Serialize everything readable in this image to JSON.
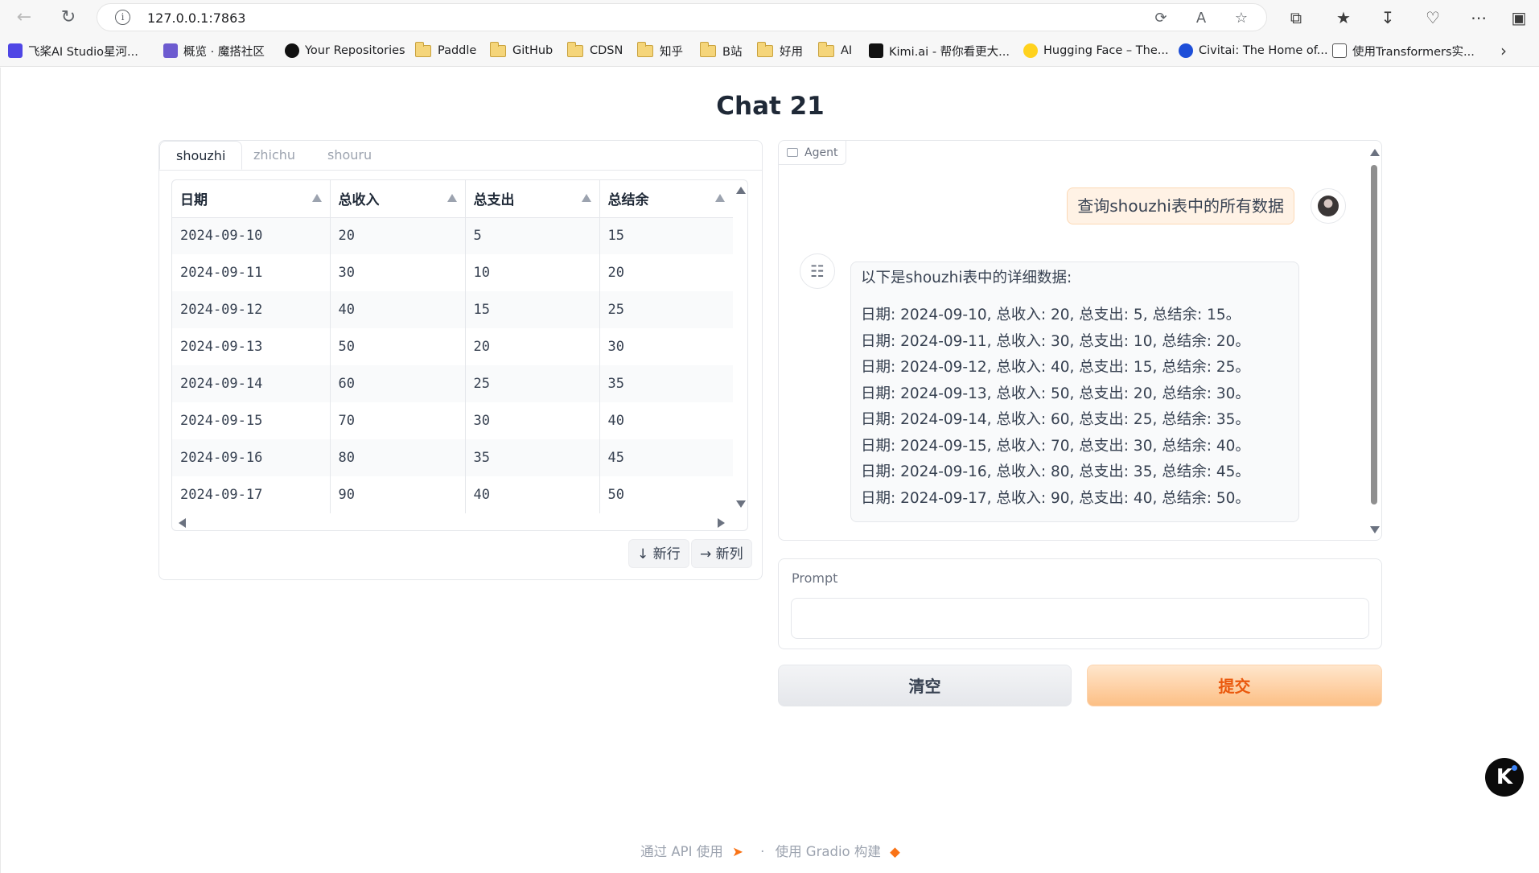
{
  "browser": {
    "url": "127.0.0.1:7863",
    "bookmarks": [
      {
        "label": "飞桨AI Studio星河...",
        "icon": "paddle-icon",
        "color": "#4f46e5"
      },
      {
        "label": "概览 · 魔搭社区",
        "icon": "modelscope-icon",
        "color": "#6d5bd0"
      },
      {
        "label": "Your Repositories",
        "icon": "github-icon",
        "color": "#111111"
      },
      {
        "label": "Paddle",
        "icon": "folder-icon"
      },
      {
        "label": "GitHub",
        "icon": "folder-icon"
      },
      {
        "label": "CDSN",
        "icon": "folder-icon"
      },
      {
        "label": "知乎",
        "icon": "folder-icon"
      },
      {
        "label": "B站",
        "icon": "folder-icon"
      },
      {
        "label": "好用",
        "icon": "folder-icon"
      },
      {
        "label": "AI",
        "icon": "folder-icon"
      },
      {
        "label": "Kimi.ai - 帮你看更大...",
        "icon": "kimi-icon",
        "color": "#111111"
      },
      {
        "label": "Hugging Face – The...",
        "icon": "huggingface-icon",
        "color": "#ffd21e"
      },
      {
        "label": "Civitai: The Home of...",
        "icon": "civitai-icon",
        "color": "#1d4ed8"
      },
      {
        "label": "使用Transformers实...",
        "icon": "page-icon",
        "color": "#555555"
      }
    ]
  },
  "app": {
    "title": "Chat 21",
    "tabs": [
      {
        "label": "shouzhi",
        "active": true
      },
      {
        "label": "zhichu",
        "active": false
      },
      {
        "label": "shouru",
        "active": false
      }
    ],
    "table": {
      "headers": [
        "日期",
        "总收入",
        "总支出",
        "总结余"
      ],
      "rows": [
        [
          "2024-09-10",
          "20",
          "5",
          "15"
        ],
        [
          "2024-09-11",
          "30",
          "10",
          "20"
        ],
        [
          "2024-09-12",
          "40",
          "15",
          "25"
        ],
        [
          "2024-09-13",
          "50",
          "20",
          "30"
        ],
        [
          "2024-09-14",
          "60",
          "25",
          "35"
        ],
        [
          "2024-09-15",
          "70",
          "30",
          "40"
        ],
        [
          "2024-09-16",
          "80",
          "35",
          "45"
        ],
        [
          "2024-09-17",
          "90",
          "40",
          "50"
        ]
      ]
    },
    "new_row_label": "↓ 新行",
    "new_col_label": "→ 新列",
    "chat": {
      "agent_label": "Agent",
      "user_message": "查询shouzhi表中的所有数据",
      "bot_intro": "以下是shouzhi表中的详细数据:",
      "bot_lines": [
        "日期: 2024-09-10, 总收入: 20, 总支出: 5, 总结余: 15。",
        "日期: 2024-09-11, 总收入: 30, 总支出: 10, 总结余: 20。",
        "日期: 2024-09-12, 总收入: 40, 总支出: 15, 总结余: 25。",
        "日期: 2024-09-13, 总收入: 50, 总支出: 20, 总结余: 30。",
        "日期: 2024-09-14, 总收入: 60, 总支出: 25, 总结余: 35。",
        "日期: 2024-09-15, 总收入: 70, 总支出: 30, 总结余: 40。",
        "日期: 2024-09-16, 总收入: 80, 总支出: 35, 总结余: 45。",
        "日期: 2024-09-17, 总收入: 90, 总支出: 40, 总结余: 50。"
      ]
    },
    "prompt": {
      "label": "Prompt",
      "value": "",
      "placeholder": ""
    },
    "clear_label": "清空",
    "submit_label": "提交",
    "footer": {
      "api": "通过 API 使用",
      "separator": "·",
      "built": "使用 Gradio 构建"
    }
  },
  "colors": {
    "accent": "#ea580c",
    "submit_bg": "#fcbf85",
    "user_bubble": "#fff2e5"
  }
}
